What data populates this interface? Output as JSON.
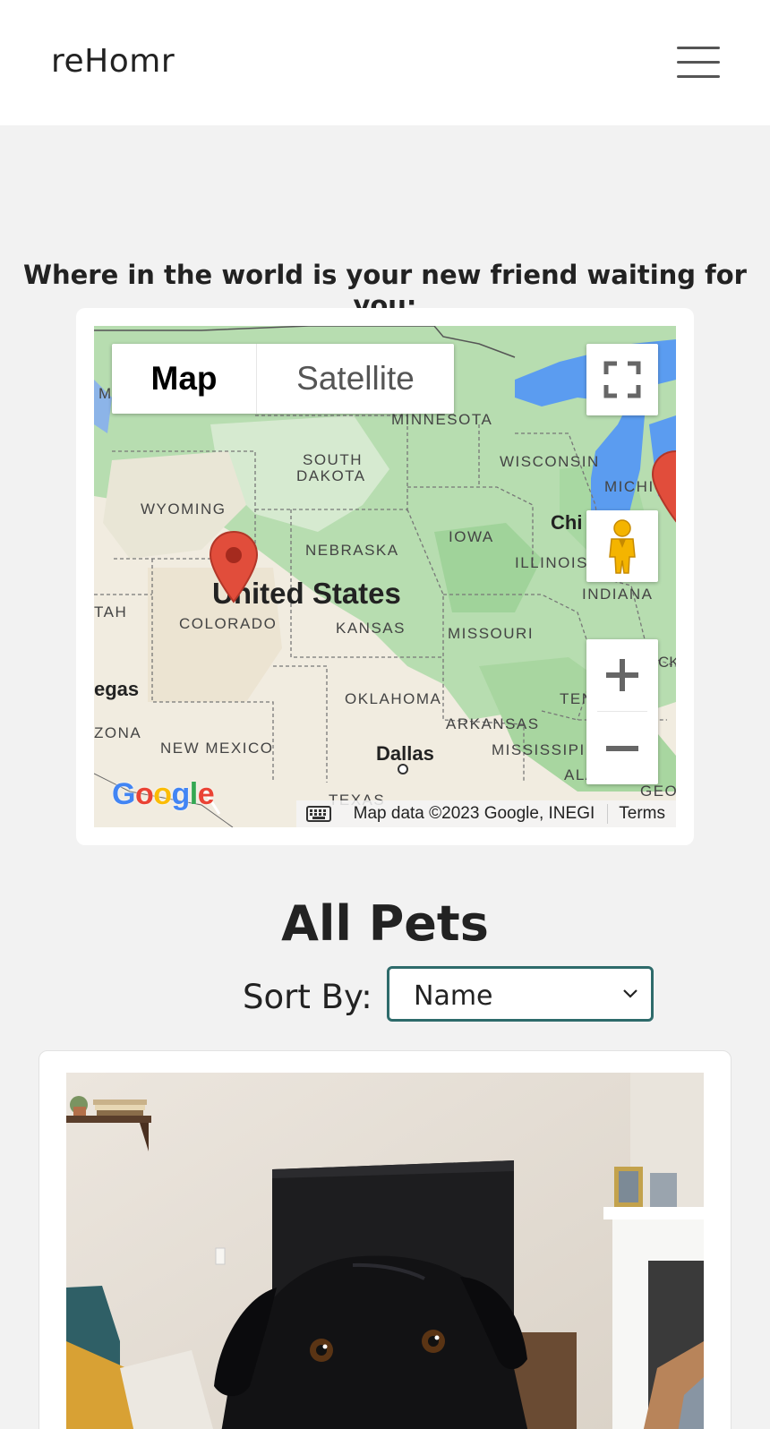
{
  "app": {
    "brand": "reHomr"
  },
  "header": {
    "menu_icon": "hamburger-menu-icon"
  },
  "map_section": {
    "heading": "Where in the world is your new friend waiting for you:",
    "map_type": {
      "map_label": "Map",
      "satellite_label": "Satellite",
      "selected": "Map"
    },
    "labels": {
      "minnesota": "MINNESOTA",
      "wisconsin": "WISCONSIN",
      "south": "SOUTH",
      "dakota": "DAKOTA",
      "wyoming": "WYOMING",
      "michigan": "MICHIG",
      "chicago": "Chi",
      "iowa": "IOWA",
      "nebraska": "NEBRASKA",
      "illinois": "ILLINOIS",
      "indiana": "INDIANA",
      "united_states": "United States",
      "utah": "TAH",
      "colorado": "COLORADO",
      "kansas": "KANSAS",
      "missouri": "MISSOURI",
      "vegas": "egas",
      "oklahoma": "OKLAHOMA",
      "tennessee": "TEN",
      "arkansas": "ARKANSAS",
      "arizona": "ZONA",
      "new_mexico": "NEW MEXICO",
      "mississippi": "MISSISSIPI",
      "dallas": "Dallas",
      "alabama": "ALABAMA",
      "texas": "TEXAS",
      "georgia": "GEO",
      "m_edge": "M",
      "ck_edge": "CK"
    },
    "markers": [
      "colorado-marker",
      "michigan-marker"
    ],
    "attribution": {
      "data": "Map data ©2023 Google, INEGI",
      "terms": "Terms"
    },
    "logo": {
      "text": "Google",
      "letters": [
        "G",
        "o",
        "o",
        "g",
        "l",
        "e"
      ]
    },
    "colors": {
      "land": "#f1ece0",
      "green": "#a8d9a8",
      "water": "#5b9cf0",
      "marker": "#e14d3b"
    }
  },
  "pets_section": {
    "title": "All Pets",
    "sort_label": "Sort By:",
    "sort_value": "Name"
  },
  "pet_card": {
    "image": "black-dog-photo"
  },
  "colors": {
    "page_bg": "#f2f2f2",
    "select_border": "#2e6b6b",
    "text": "#222222"
  }
}
